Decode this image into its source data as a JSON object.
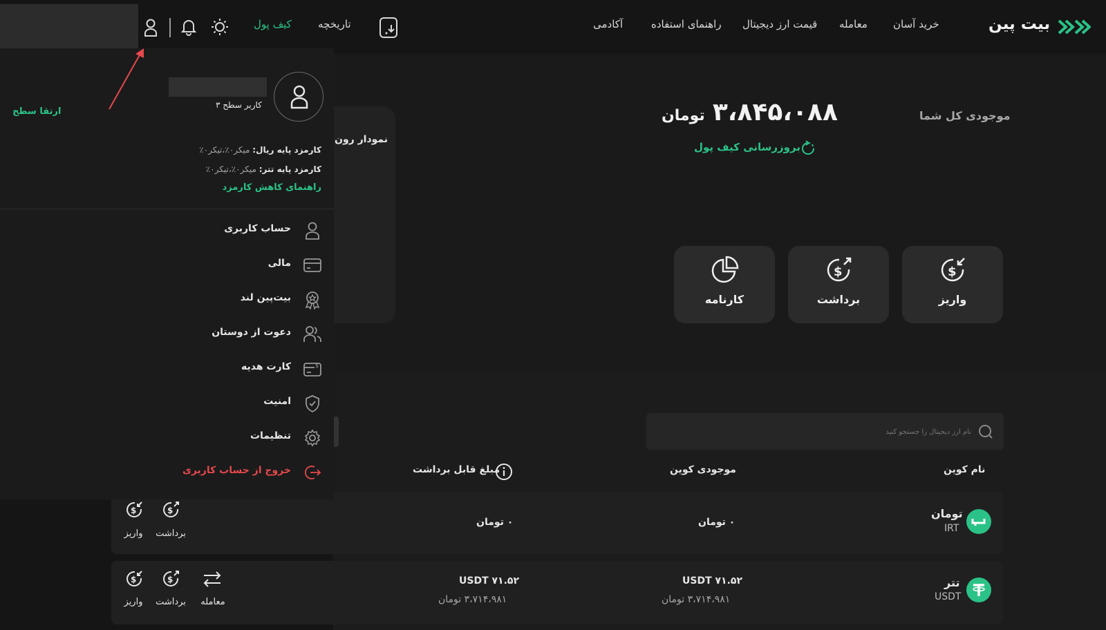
{
  "header": {
    "logo_text": "بیت پین",
    "nav": [
      "خرید آسان",
      "معامله",
      "قیمت ارز دیجیتال",
      "راهنمای استفاده",
      "آکادمی"
    ],
    "wallet_label": "کیف پول",
    "history_label": "تاریخچه"
  },
  "dropdown": {
    "upgrade_label": "ارتقا سطح",
    "user_level": "کاربر سطح ۳",
    "fee_rial_label": "کارمزد پایه ریال:",
    "fee_rial_value": "میکر۰٪،تیکر۰٪",
    "fee_usdt_label": "کارمزد پایه تتر:",
    "fee_usdt_value": "میکر۰٪،تیکر۰٪",
    "fee_guide_link": "راهنمای کاهش کارمزد",
    "menu": [
      {
        "label": "حساب کاربری",
        "icon": "user-icon"
      },
      {
        "label": "مالی",
        "icon": "card-icon"
      },
      {
        "label": "بیت‌پین لند",
        "icon": "badge-icon"
      },
      {
        "label": "دعوت از دوستان",
        "icon": "users-icon"
      },
      {
        "label": "کارت هدیه",
        "icon": "gift-card-icon"
      },
      {
        "label": "امنیت",
        "icon": "shield-icon"
      },
      {
        "label": "تنظیمات",
        "icon": "gear-icon"
      }
    ],
    "logout_label": "خروج از حساب کاربری"
  },
  "balance": {
    "label": "موجودی کل شما",
    "amount": "۳،۸۴۵،۰۸۸",
    "currency": "تومان",
    "refresh_label": "بروزرسانی کیف پول"
  },
  "chart_panel_title": "نمودار رون",
  "actions": [
    {
      "label": "واریز",
      "icon": "deposit-icon"
    },
    {
      "label": "برداشت",
      "icon": "withdraw-icon"
    },
    {
      "label": "کارنامه",
      "icon": "pie-chart-icon"
    }
  ],
  "search": {
    "placeholder": "نام ارز دیجیتال را جستجو کنید"
  },
  "table": {
    "headers": {
      "coin": "نام کوین",
      "balance": "موجودی کوین",
      "withdrawable": "مبلغ قابل برداشت"
    },
    "rows": [
      {
        "name": "تومان",
        "symbol": "IRT",
        "balance": "۰ تومان",
        "balance_sub": "",
        "withdrawable": "۰ تومان",
        "withdrawable_sub": "",
        "actions": [
          "برداشت",
          "واریز"
        ]
      },
      {
        "name": "تتر",
        "symbol": "USDT",
        "balance": "۷۱.۵۲ USDT",
        "balance_sub": "۳،۷۱۴،۹۸۱ تومان",
        "withdrawable": "۷۱.۵۲ USDT",
        "withdrawable_sub": "۳،۷۱۴،۹۸۱ تومان",
        "actions": [
          "معامله",
          "برداشت",
          "واریز"
        ]
      }
    ]
  },
  "colors": {
    "accent": "#2bc287",
    "danger": "#e5484d",
    "annotation": "#e5484d"
  }
}
